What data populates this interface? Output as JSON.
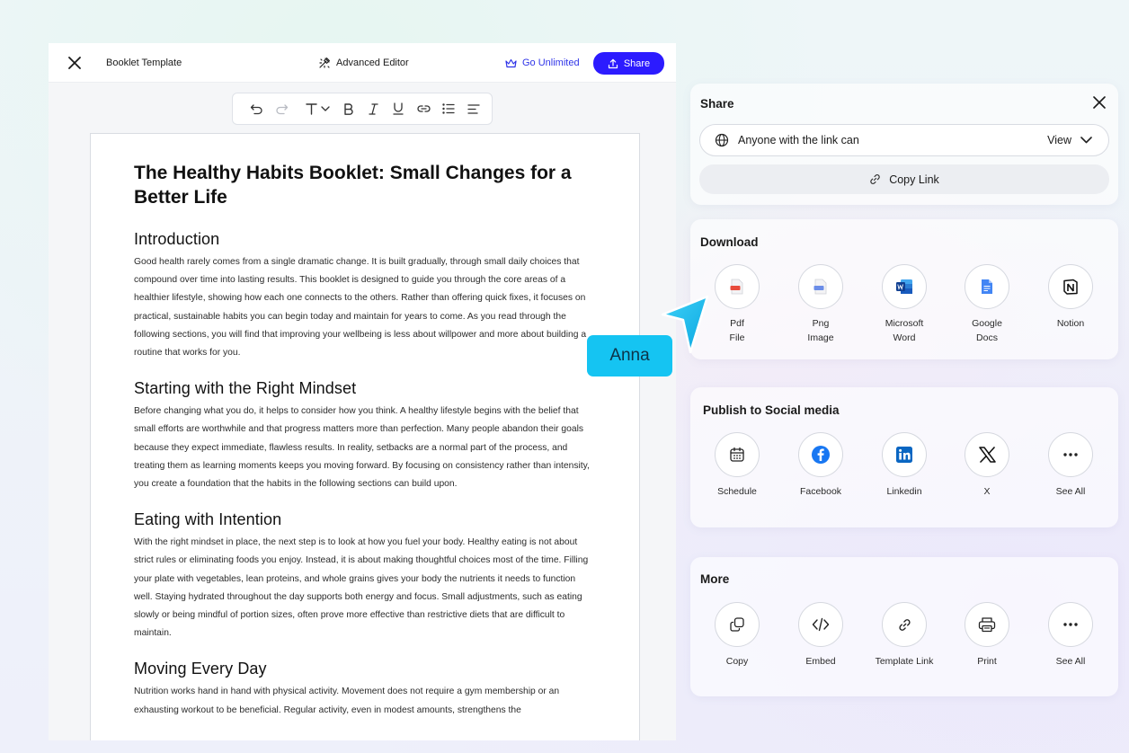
{
  "editor": {
    "doc_title": "Booklet Template",
    "advanced_editor_label": "Advanced Editor",
    "go_unlimited_label": "Go Unlimited",
    "share_label": "Share"
  },
  "toolbar": {
    "tools": [
      "undo",
      "redo",
      "text-size",
      "bold",
      "italic",
      "underline",
      "link",
      "list",
      "align"
    ]
  },
  "document": {
    "title": "The Healthy Habits Booklet: Small Changes for a Better Life",
    "sections": [
      {
        "heading": "Introduction",
        "body": "Good health rarely comes from a single dramatic change. It is built gradually, through small daily choices that compound over time into lasting results. This booklet is designed to guide you through the core areas of a healthier lifestyle, showing how each one connects to the others. Rather than offering quick fixes, it focuses on practical, sustainable habits you can begin today and maintain for years to come. As you read through the following sections, you will find that improving your wellbeing is less about willpower and more about building a routine that works for you."
      },
      {
        "heading": "Starting with the Right Mindset",
        "body": "Before changing what you do, it helps to consider how you think. A healthy lifestyle begins with the belief that small efforts are worthwhile and that progress matters more than perfection. Many people abandon their goals because they expect immediate, flawless results. In reality, setbacks are a normal part of the process, and treating them as learning moments keeps you moving forward. By focusing on consistency rather than intensity, you create a foundation that the habits in the following sections can build upon."
      },
      {
        "heading": "Eating with Intention",
        "body": "With the right mindset in place, the next step is to look at how you fuel your body. Healthy eating is not about strict rules or eliminating foods you enjoy. Instead, it is about making thoughtful choices most of the time. Filling your plate with vegetables, lean proteins, and whole grains gives your body the nutrients it needs to function well. Staying hydrated throughout the day supports both energy and focus. Small adjustments, such as eating slowly or being mindful of portion sizes, often prove more effective than restrictive diets that are difficult to maintain."
      },
      {
        "heading": "Moving Every Day",
        "body": "Nutrition works hand in hand with physical activity. Movement does not require a gym membership or an exhausting workout to be beneficial. Regular activity, even in modest amounts, strengthens the"
      }
    ]
  },
  "share_panel": {
    "title": "Share",
    "access_text": "Anyone with the link can",
    "access_value": "View",
    "copy_link_label": "Copy Link"
  },
  "download_panel": {
    "title": "Download",
    "items": [
      {
        "label": "Pdf\nFile",
        "icon": "pdf-icon"
      },
      {
        "label": "Png\nImage",
        "icon": "png-icon"
      },
      {
        "label": "Microsoft\nWord",
        "icon": "word-icon"
      },
      {
        "label": "Google\nDocs",
        "icon": "google-docs-icon"
      },
      {
        "label": "Notion",
        "icon": "notion-icon"
      }
    ]
  },
  "social_panel": {
    "title": "Publish to Social media",
    "items": [
      {
        "label": "Schedule",
        "icon": "calendar-icon"
      },
      {
        "label": "Facebook",
        "icon": "facebook-icon"
      },
      {
        "label": "Linkedin",
        "icon": "linkedin-icon"
      },
      {
        "label": "X",
        "icon": "x-icon"
      },
      {
        "label": "See All",
        "icon": "more-icon"
      }
    ]
  },
  "more_panel": {
    "title": "More",
    "items": [
      {
        "label": "Copy",
        "icon": "copy-icon"
      },
      {
        "label": "Embed",
        "icon": "embed-icon"
      },
      {
        "label": "Template Link",
        "icon": "link-icon"
      },
      {
        "label": "Print",
        "icon": "print-icon"
      },
      {
        "label": "See All",
        "icon": "more-icon"
      }
    ]
  },
  "cursor": {
    "user_name": "Anna",
    "color": "#15c4f2"
  },
  "colors": {
    "primary": "#2c1bff",
    "go_unlimited": "#2f34e8"
  }
}
